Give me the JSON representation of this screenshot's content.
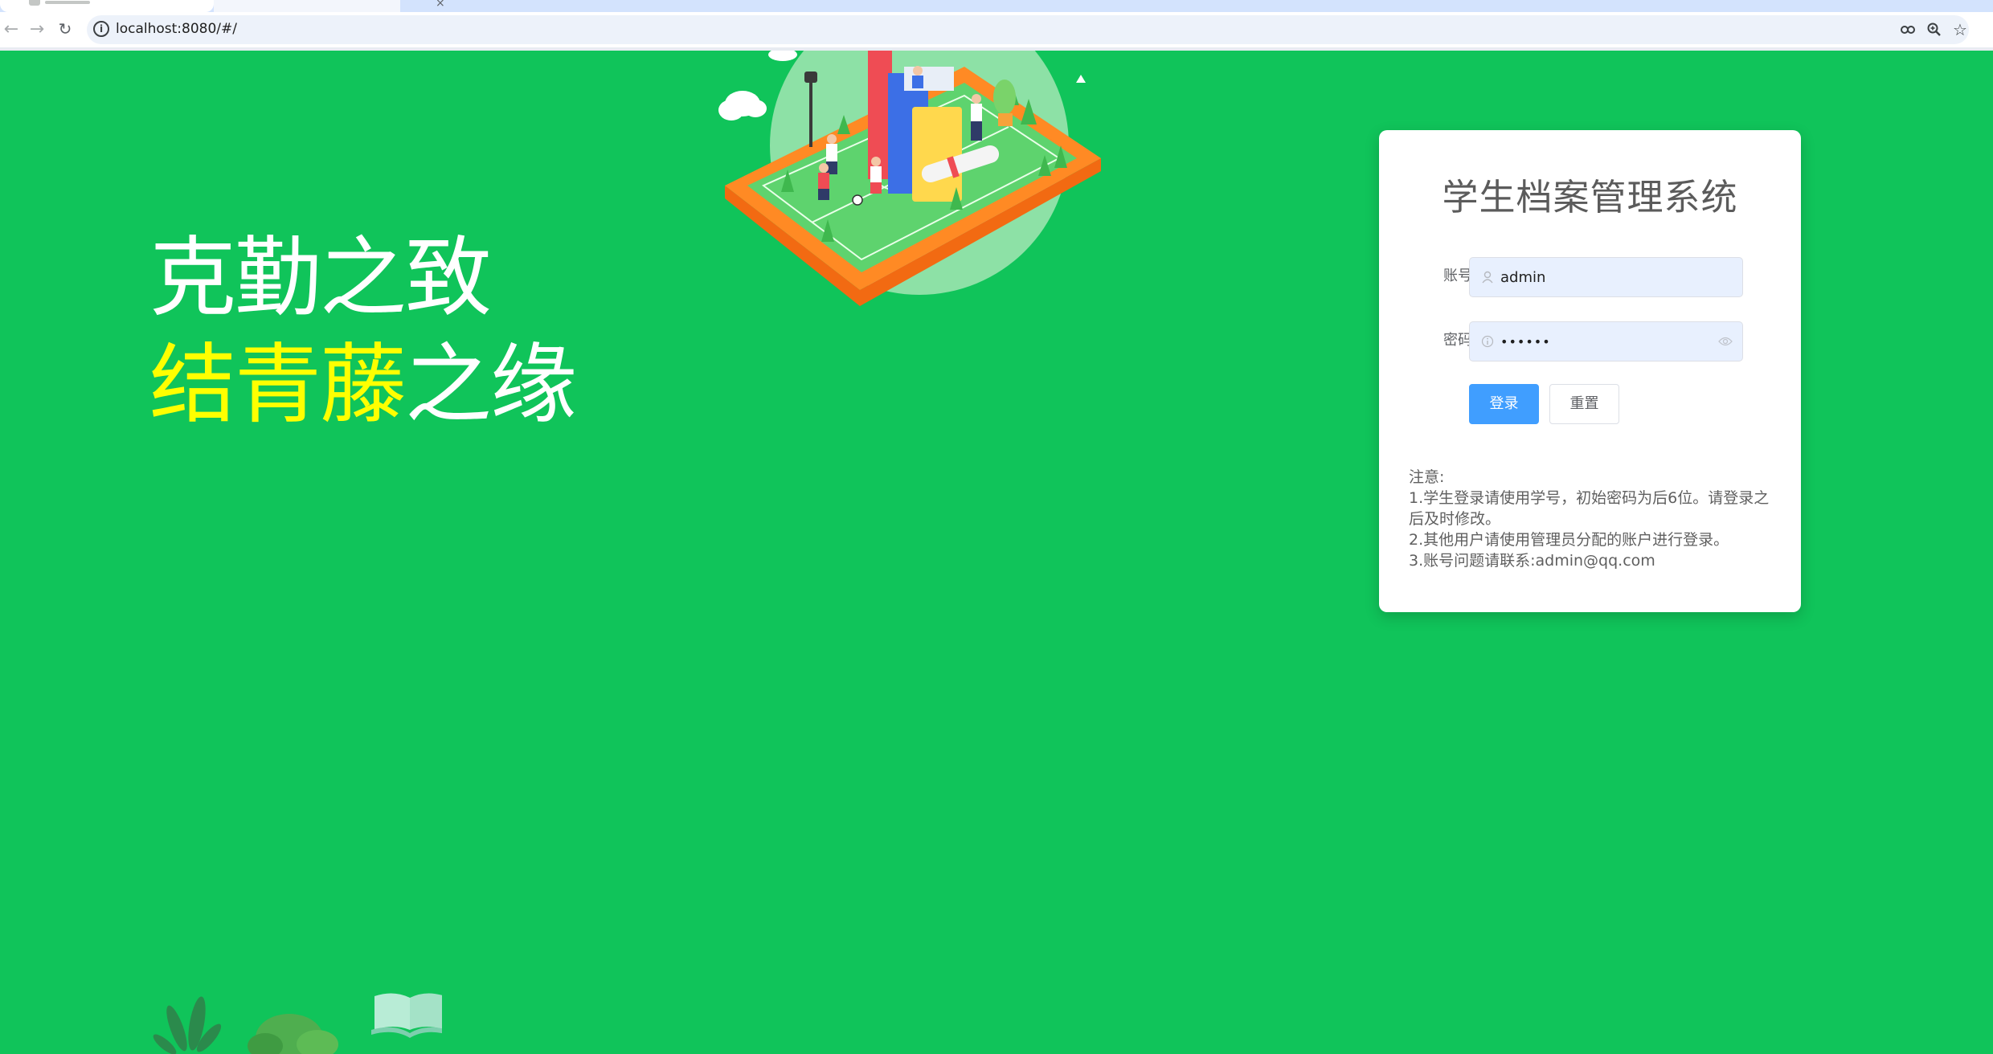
{
  "browser": {
    "url": "localhost:8080/#/"
  },
  "hero": {
    "line1": "克勤之致",
    "line2_highlight": "结青藤",
    "line2_rest": "之缘"
  },
  "login": {
    "title": "学生档案管理系统",
    "account_label": "账号",
    "account_value": "admin",
    "password_label": "密码",
    "password_value": "••••••",
    "login_button": "登录",
    "reset_button": "重置",
    "notice": {
      "heading": "注意:",
      "items": [
        "1.学生登录请使用学号，初始密码为后6位。请登录之后及时修改。",
        "2.其他用户请使用管理员分配的账户进行登录。",
        "3.账号问题请联系:admin@qq.com"
      ]
    }
  },
  "colors": {
    "background": "#10c45a",
    "highlight": "#ffff00",
    "primary_button": "#409eff"
  },
  "icons": {
    "back": "arrow-left-icon",
    "forward": "arrow-right-icon",
    "reload": "reload-icon",
    "site_info": "info-icon",
    "password_manager": "key-icon",
    "zoom": "zoom-in-icon",
    "bookmark": "star-icon",
    "account_prefix": "user-icon",
    "password_prefix": "lock-icon",
    "password_toggle": "eye-icon"
  }
}
